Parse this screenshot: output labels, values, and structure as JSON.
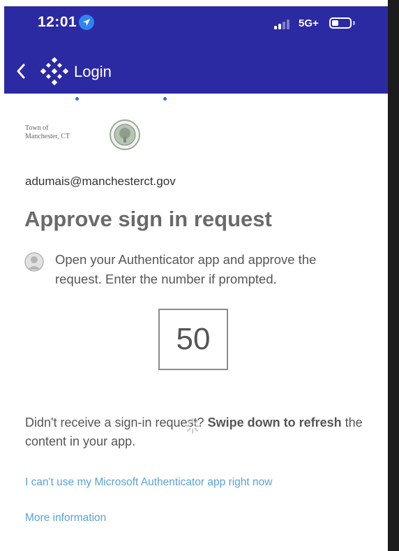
{
  "status_bar": {
    "time": "12:01",
    "network": "5G+"
  },
  "nav": {
    "title": "Login"
  },
  "org": {
    "line1": "Town of",
    "line2": "Manchester, CT"
  },
  "account": {
    "email": "adumais@manchesterct.gov"
  },
  "main": {
    "heading": "Approve sign in request",
    "instructions": "Open your Authenticator app and approve the request. Enter the number if prompted.",
    "number": "50",
    "resend_prefix": "Didn't receive a sign-in request? ",
    "resend_bold": "Swipe down to refresh",
    "resend_suffix": " the content in your app."
  },
  "links": {
    "cant_use": "I can't use my Microsoft Authenticator app right now",
    "more_info": "More information"
  },
  "colors": {
    "header_bg": "#2b2aa3",
    "link": "#5aa2d8",
    "location_icon": "#2f84f0"
  }
}
